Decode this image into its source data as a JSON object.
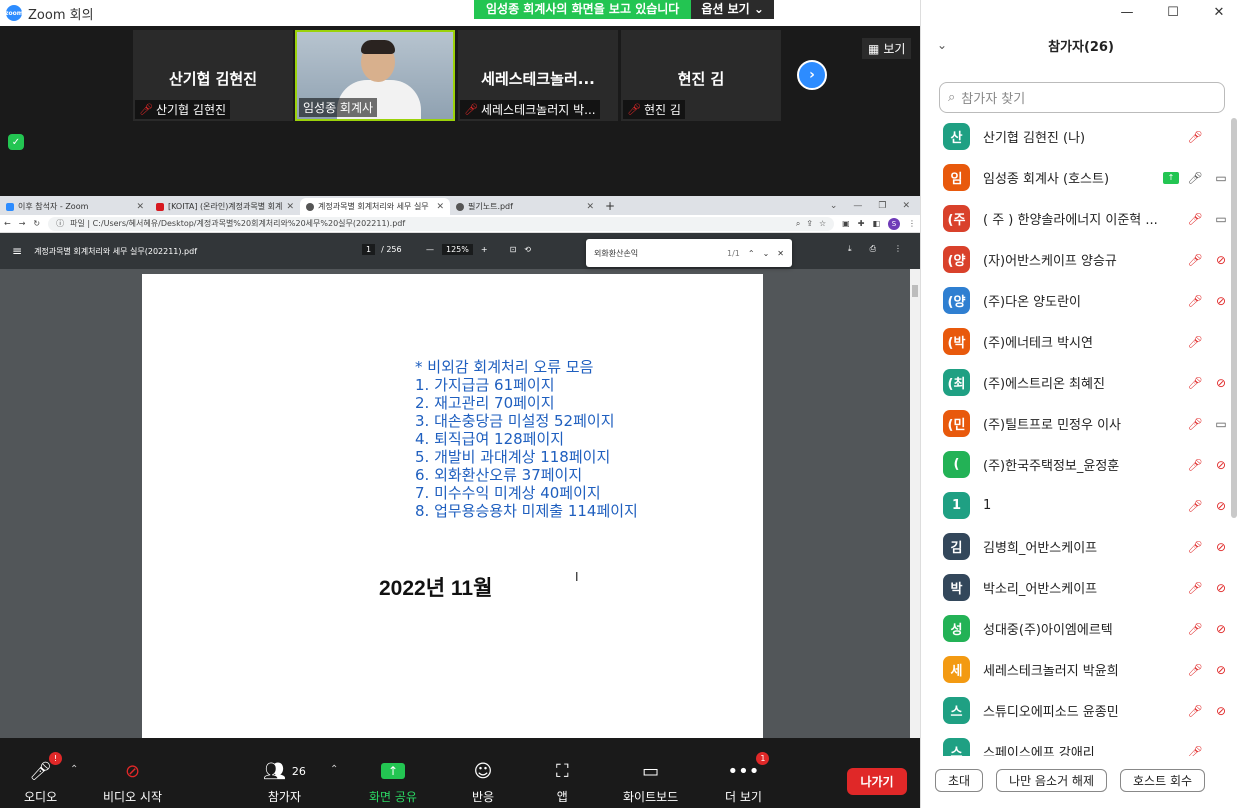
{
  "window": {
    "title": "Zoom 회의"
  },
  "share_banner": {
    "message": "임성종 회계사의 화면을 보고 있습니다",
    "options": "옵션 보기"
  },
  "gallery": {
    "view_label": "보기",
    "tiles": [
      {
        "name": "산기협 김현진",
        "caption": "산기협 김현진"
      },
      {
        "name": "",
        "caption": "임성종 회계사"
      },
      {
        "name": "세레스테크놀러...",
        "caption": "세레스테크놀러지 박..."
      },
      {
        "name": "현진 김",
        "caption": "현진 김"
      }
    ]
  },
  "browser": {
    "tabs": [
      {
        "label": "이후 참석자 - Zoom",
        "color": "#2d8cff"
      },
      {
        "label": "[KOITA] (온라인)계정과목별 회계",
        "color": "#d71920"
      },
      {
        "label": "계정과목별 회계처리와 세무 실무",
        "color": "#555555"
      },
      {
        "label": "필기노트.pdf",
        "color": "#555555"
      }
    ],
    "address": "파일 | C:/Users/혜서혜유/Desktop/계정과목별%20회계처리와%20세무%20실무(202211).pdf",
    "pdf_title": "계정과목별 회계처리와 세무 실무(202211).pdf",
    "page_current": "1",
    "page_total": "/ 256",
    "zoom": "125%",
    "find_query": "외화환산손익",
    "find_count": "1/1",
    "pdf_lines": [
      "* 비외감 회계처리 오류 모음",
      "1. 가지급금 61페이지",
      "2. 재고관리 70페이지",
      "3. 대손충당금 미설정 52페이지",
      "4. 퇴직급여 128페이지",
      "5. 개발비 과대계상 118페이지",
      "6. 외화환산오류 37페이지",
      "7. 미수수익 미계상 40페이지",
      "8. 업무용승용차 미제출 114페이지"
    ],
    "pdf_year": "2022년 11월"
  },
  "participants": {
    "title": "참가자(26)",
    "search_placeholder": "참가자 찾기",
    "list": [
      {
        "initial": "산",
        "name": "산기협 김현진 (나)",
        "color": "#1fa083"
      },
      {
        "initial": "임",
        "name": "임성종 회계사 (호스트)",
        "color": "#e8590c"
      },
      {
        "initial": "(주",
        "name": "( 주 ) 한양솔라에너지 이준혁 ...",
        "color": "#d9412b"
      },
      {
        "initial": "(양",
        "name": "(자)어반스케이프 양승규",
        "color": "#d9412b"
      },
      {
        "initial": "(양",
        "name": "(주)다온 양도란이",
        "color": "#2f7fd1"
      },
      {
        "initial": "(박",
        "name": "(주)에너테크 박시연",
        "color": "#e8590c"
      },
      {
        "initial": "(최",
        "name": "(주)에스트리온 최혜진",
        "color": "#1fa083"
      },
      {
        "initial": "(민",
        "name": "(주)틸트프로 민정우 이사",
        "color": "#e8590c"
      },
      {
        "initial": "(",
        "name": "(주)한국주택정보_윤정훈",
        "color": "#23b256"
      },
      {
        "initial": "1",
        "name": "1",
        "color": "#1fa083"
      },
      {
        "initial": "김",
        "name": "김병희_어반스케이프",
        "color": "#33475b"
      },
      {
        "initial": "박",
        "name": "박소리_어반스케이프",
        "color": "#33475b"
      },
      {
        "initial": "성",
        "name": "성대중(주)아이엠에르텍",
        "color": "#23b256"
      },
      {
        "initial": "세",
        "name": "세레스테크놀러지 박윤희",
        "color": "#f39a12"
      },
      {
        "initial": "스",
        "name": "스튜디오에피소드 윤종민",
        "color": "#1fa083"
      },
      {
        "initial": "스",
        "name": "스페이스에프 강애리",
        "color": "#1fa083"
      }
    ],
    "buttons": {
      "invite": "초대",
      "unmute_me": "나만 음소거 해제",
      "reclaim_host": "호스트 회수"
    }
  },
  "toolbar": {
    "audio": "오디오",
    "video": "비디오 시작",
    "participants": "참가자",
    "participants_count": "26",
    "share": "화면 공유",
    "reactions": "반응",
    "apps": "앱",
    "whiteboard": "화이트보드",
    "more": "더 보기",
    "more_badge": "1",
    "audio_badge": "!",
    "leave": "나가기"
  },
  "colors": {
    "accent": "#2d8cff",
    "share_green": "#23c552",
    "alert_red": "#e02828"
  }
}
